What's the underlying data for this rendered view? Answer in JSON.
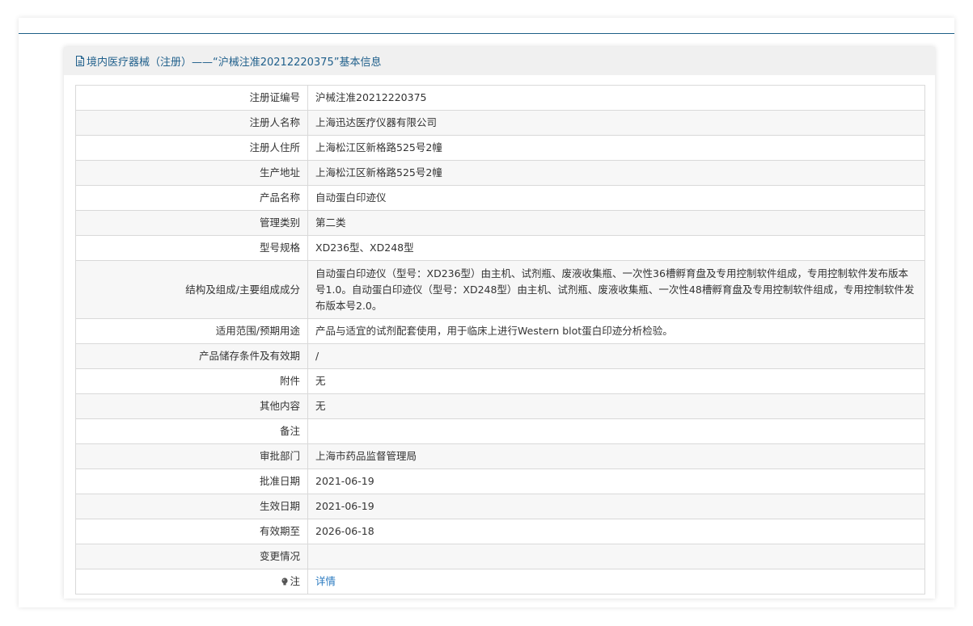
{
  "header": {
    "title": "境内医疗器械（注册）——“沪械注准20212220375”基本信息",
    "icon": "document-icon"
  },
  "rows": [
    {
      "label": "注册证编号",
      "value": "沪械注准20212220375"
    },
    {
      "label": "注册人名称",
      "value": "上海迅达医疗仪器有限公司"
    },
    {
      "label": "注册人住所",
      "value": "上海松江区新格路525号2幢"
    },
    {
      "label": "生产地址",
      "value": "上海松江区新格路525号2幢"
    },
    {
      "label": "产品名称",
      "value": "自动蛋白印迹仪"
    },
    {
      "label": "管理类别",
      "value": "第二类"
    },
    {
      "label": "型号规格",
      "value": "XD236型、XD248型"
    },
    {
      "label": "结构及组成/主要组成成分",
      "value": "自动蛋白印迹仪（型号：XD236型）由主机、试剂瓶、废液收集瓶、一次性36槽孵育盘及专用控制软件组成，专用控制软件发布版本号1.0。自动蛋白印迹仪（型号：XD248型）由主机、试剂瓶、废液收集瓶、一次性48槽孵育盘及专用控制软件组成，专用控制软件发布版本号2.0。"
    },
    {
      "label": "适用范围/预期用途",
      "value": "产品与适宜的试剂配套使用，用于临床上进行Western blot蛋白印迹分析检验。"
    },
    {
      "label": "产品储存条件及有效期",
      "value": "/"
    },
    {
      "label": "附件",
      "value": "无"
    },
    {
      "label": "其他内容",
      "value": "无"
    },
    {
      "label": "备注",
      "value": ""
    },
    {
      "label": "审批部门",
      "value": "上海市药品监督管理局"
    },
    {
      "label": "批准日期",
      "value": "2021-06-19"
    },
    {
      "label": "生效日期",
      "value": "2021-06-19"
    },
    {
      "label": "有效期至",
      "value": "2026-06-18"
    },
    {
      "label": "变更情况",
      "value": ""
    }
  ],
  "note_row": {
    "label": "注",
    "icon": "lightbulb-icon",
    "link_text": "详情"
  },
  "colors": {
    "accent": "#1f5f8b",
    "link": "#2a7ac0",
    "header_bg": "#f0f0f0",
    "row_alt_bg": "#f7f7f7",
    "border": "#d9d9d9"
  }
}
